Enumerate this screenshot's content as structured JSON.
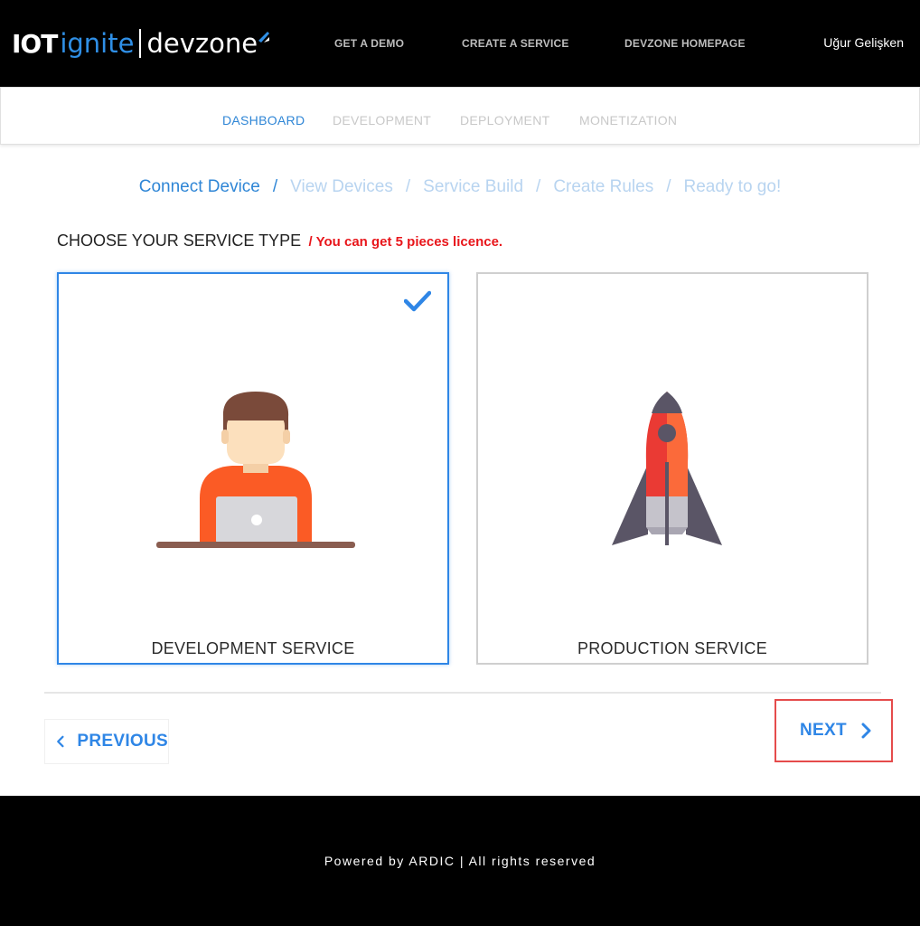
{
  "header": {
    "logo": {
      "part1": "IOT",
      "part2": "ignite",
      "part3": "devzone"
    },
    "nav": [
      {
        "label": "GET A DEMO"
      },
      {
        "label": "CREATE A SERVICE"
      },
      {
        "label": "DEVZONE HOMEPAGE"
      }
    ],
    "user_name": "Uğur Gelişken"
  },
  "subnav": {
    "items": [
      {
        "label": "DASHBOARD",
        "active": true
      },
      {
        "label": "DEVELOPMENT",
        "active": false
      },
      {
        "label": "DEPLOYMENT",
        "active": false
      },
      {
        "label": "MONETIZATION",
        "active": false
      }
    ]
  },
  "steps": {
    "separator": "/",
    "items": [
      {
        "label": "Connect Device",
        "active": true
      },
      {
        "label": "View Devices",
        "active": false
      },
      {
        "label": "Service Build",
        "active": false
      },
      {
        "label": "Create Rules",
        "active": false
      },
      {
        "label": "Ready to go!",
        "active": false
      }
    ]
  },
  "section": {
    "title": "CHOOSE YOUR SERVICE TYPE",
    "note": "/ You can get 5 pieces licence."
  },
  "cards": [
    {
      "label": "DEVELOPMENT SERVICE",
      "selected": true,
      "icon": "developer-icon"
    },
    {
      "label": "PRODUCTION SERVICE",
      "selected": false,
      "icon": "rocket-icon"
    }
  ],
  "buttons": {
    "previous": "PREVIOUS",
    "next": "NEXT"
  },
  "footer": {
    "text": "Powered by ARDIC | All rights reserved"
  },
  "colors": {
    "accent": "#2f86e6",
    "warning": "#e8161b",
    "highlight_border": "#e54b4b"
  }
}
